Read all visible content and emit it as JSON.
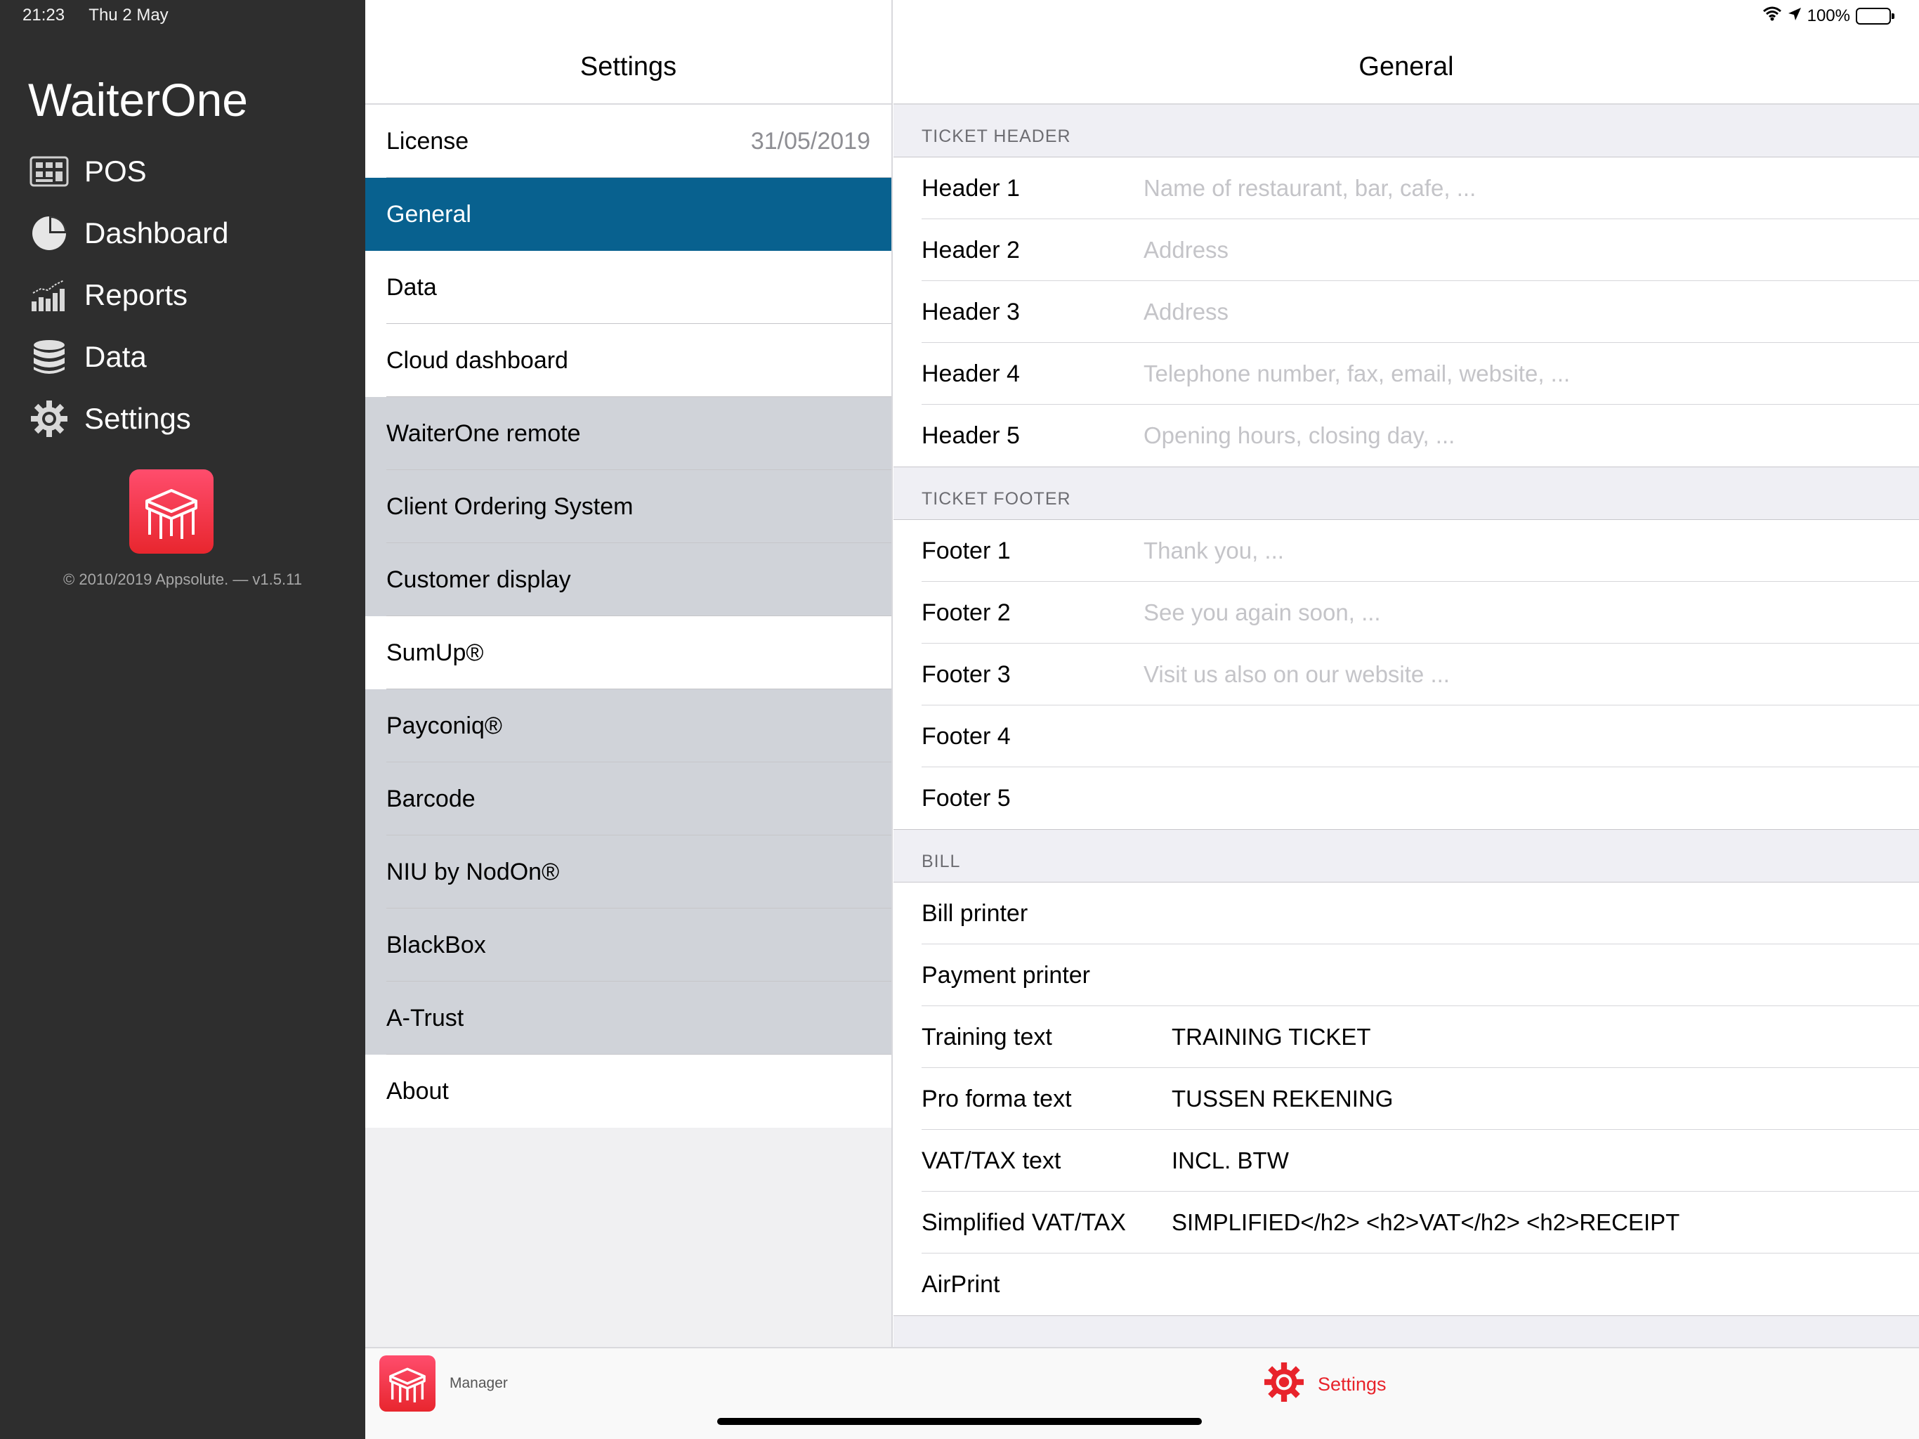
{
  "status_bar": {
    "time": "21:23",
    "date": "Thu 2 May",
    "battery": "100%"
  },
  "sidebar": {
    "app_title": "WaiterOne",
    "items": [
      {
        "label": "POS",
        "icon": "cash-register-icon"
      },
      {
        "label": "Dashboard",
        "icon": "pie-chart-icon"
      },
      {
        "label": "Reports",
        "icon": "bar-chart-icon"
      },
      {
        "label": "Data",
        "icon": "database-icon"
      },
      {
        "label": "Settings",
        "icon": "gear-icon"
      }
    ],
    "copyright": "© 2010/2019 Appsolute. — v1.5.11"
  },
  "settings_column": {
    "title": "Settings",
    "items": [
      {
        "label": "License",
        "value": "31/05/2019"
      },
      {
        "label": "General"
      },
      {
        "label": "Data"
      },
      {
        "label": "Cloud dashboard"
      },
      {
        "label": "WaiterOne remote"
      },
      {
        "label": "Client Ordering System"
      },
      {
        "label": "Customer display"
      },
      {
        "label": "SumUp®"
      },
      {
        "label": "Payconiq®"
      },
      {
        "label": "Barcode"
      },
      {
        "label": "NIU by NodOn®"
      },
      {
        "label": "BlackBox"
      },
      {
        "label": "A-Trust"
      },
      {
        "label": "About"
      }
    ]
  },
  "general": {
    "title": "General",
    "ticket_header": {
      "label": "TICKET HEADER",
      "rows": [
        {
          "label": "Header 1",
          "placeholder": "Name of restaurant, bar, cafe, ..."
        },
        {
          "label": "Header 2",
          "placeholder": "Address"
        },
        {
          "label": "Header 3",
          "placeholder": "Address"
        },
        {
          "label": "Header 4",
          "placeholder": "Telephone number, fax, email, website, ..."
        },
        {
          "label": "Header 5",
          "placeholder": "Opening hours, closing day, ..."
        }
      ]
    },
    "ticket_footer": {
      "label": "TICKET FOOTER",
      "rows": [
        {
          "label": "Footer 1",
          "placeholder": "Thank you, ..."
        },
        {
          "label": "Footer 2",
          "placeholder": "See you again soon, ..."
        },
        {
          "label": "Footer 3",
          "placeholder": "Visit us also on our website ..."
        },
        {
          "label": "Footer 4",
          "placeholder": ""
        },
        {
          "label": "Footer 5",
          "placeholder": ""
        }
      ]
    },
    "bill": {
      "label": "BILL",
      "rows": [
        {
          "label": "Bill printer",
          "value": ""
        },
        {
          "label": "Payment printer",
          "value": ""
        },
        {
          "label": "Training text",
          "value": "TRAINING TICKET"
        },
        {
          "label": "Pro forma text",
          "value": "TUSSEN REKENING"
        },
        {
          "label": "VAT/TAX text",
          "value": "INCL. BTW"
        },
        {
          "label": "Simplified VAT/TAX",
          "value": "SIMPLIFIED</h2> <h2>VAT</h2> <h2>RECEIPT"
        },
        {
          "label": "AirPrint",
          "value": ""
        }
      ]
    }
  },
  "tabbar": {
    "manager_label": "Manager",
    "settings_label": "Settings"
  },
  "colors": {
    "sidebar_bg": "#2e2e2e",
    "selected_bg": "#08618f",
    "accent_red": "#e8232b"
  }
}
